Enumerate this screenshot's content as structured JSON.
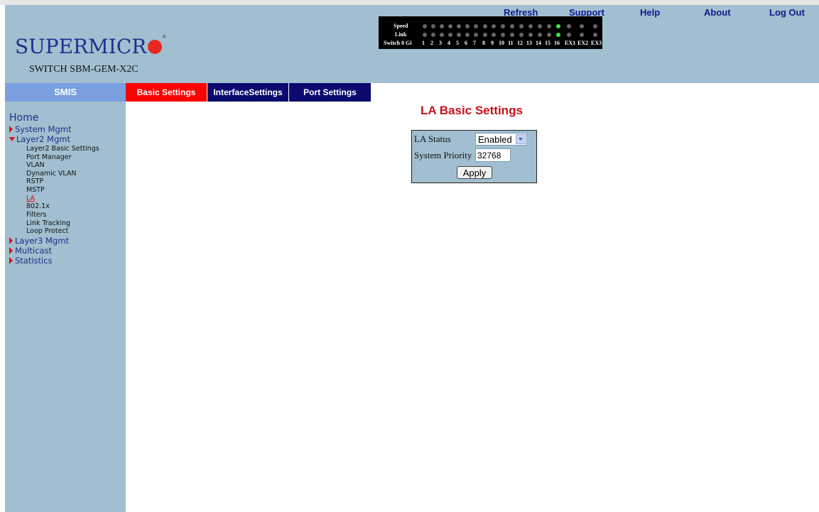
{
  "header": {
    "logo_text": "SUPERMICR",
    "switch_name": "SWITCH SBM-GEM-X2C",
    "links": [
      "Refresh",
      "Support",
      "Help",
      "About",
      "Log Out"
    ]
  },
  "led_panel": {
    "speed_label": "Speed",
    "link_label": "Link",
    "ports_prefix": "Switch 0 Gi",
    "ports": [
      "1",
      "2",
      "3",
      "4",
      "5",
      "6",
      "7",
      "8",
      "9",
      "10",
      "11",
      "12",
      "13",
      "14",
      "15",
      "16",
      "EX1",
      "EX2",
      "EX3"
    ],
    "speed_on_index": 15,
    "link_on_index": 15,
    "led_on_color": "#3ee83e",
    "led_off_color": "#666666"
  },
  "nav": {
    "smis_label": "SMIS",
    "tabs": [
      {
        "label": "Basic Settings",
        "active": true
      },
      {
        "label": "InterfaceSettings",
        "active": false
      },
      {
        "label": "Port Settings",
        "active": false
      }
    ]
  },
  "sidebar": {
    "home": "Home",
    "system_mgmt": "System Mgmt",
    "layer2_mgmt": "Layer2 Mgmt",
    "layer2_items": [
      "Layer2 Basic Settings",
      "Port Manager",
      "VLAN",
      "Dynamic VLAN",
      "RSTP",
      "MSTP",
      "LA",
      "802.1x",
      "Filters",
      "Link Tracking",
      "Loop Protect"
    ],
    "layer3_mgmt": "Layer3 Mgmt",
    "multicast": "Multicast",
    "statistics": "Statistics"
  },
  "main": {
    "title": "LA Basic Settings",
    "la_status_label": "LA Status",
    "la_status_value": "Enabled",
    "system_priority_label": "System Priority",
    "system_priority_value": "32768",
    "apply_label": "Apply"
  },
  "colors": {
    "header_bg": "#a1bfd0",
    "tab_active": "#ff0000",
    "tab_inactive": "#0a0a6e",
    "smis_bg": "#7a9fdf",
    "title_red": "#c8101a",
    "link_blue": "#0f1a8c"
  }
}
